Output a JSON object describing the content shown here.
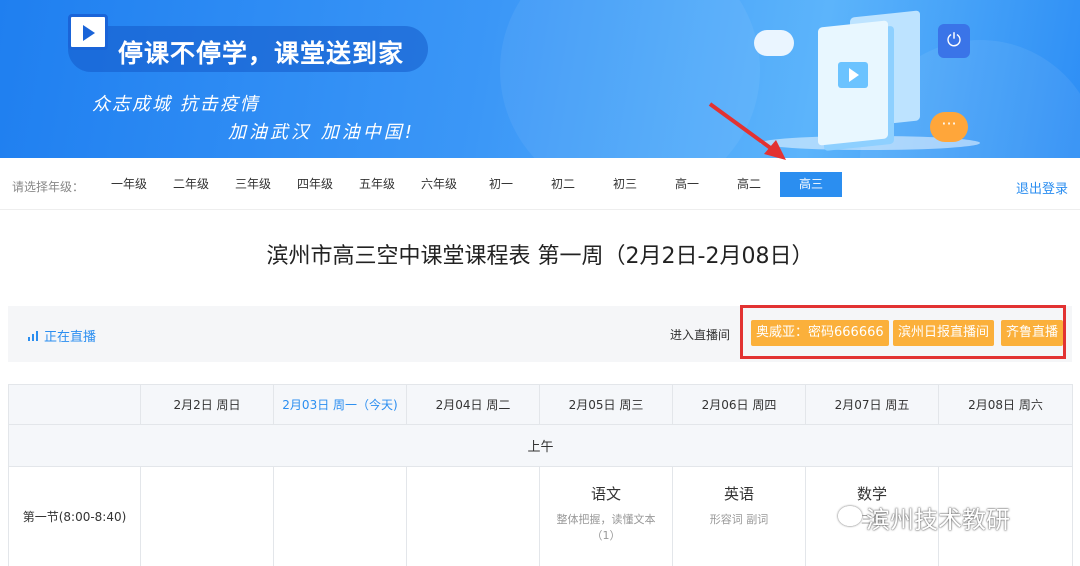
{
  "banner": {
    "title": "停课不停学，课堂送到家",
    "slogan_line1": "众志成城  抗击疫情",
    "slogan_line2": "加油武汉  加油中国!",
    "icon": "video-play-icon"
  },
  "grade_bar": {
    "label": "请选择年级：",
    "grades": [
      "一年级",
      "二年级",
      "三年级",
      "四年级",
      "五年级",
      "六年级",
      "初一",
      "初二",
      "初三",
      "高一",
      "高二",
      "高三"
    ],
    "selected": "高三",
    "logout": "退出登录"
  },
  "page_title": "滨州市高三空中课堂课程表 第一周（2月2日-2月08日）",
  "live_bar": {
    "status": "正在直播",
    "enter_label": "进入直播间",
    "buttons": [
      "奥威亚：密码666666",
      "滨州日报直播间",
      "齐鲁直播"
    ]
  },
  "schedule": {
    "headers": [
      "",
      "2月2日 周日",
      "2月03日 周一（今天)",
      "2月04日 周二",
      "2月05日 周三",
      "2月06日 周四",
      "2月07日 周五",
      "2月08日 周六"
    ],
    "section": "上午",
    "periods": [
      {
        "label": "第一节(8:00-8:40)",
        "cells": [
          {
            "subject": "",
            "topic": ""
          },
          {
            "subject": "",
            "topic": ""
          },
          {
            "subject": "",
            "topic": ""
          },
          {
            "subject": "语文",
            "topic": "整体把握，读懂文本（1）"
          },
          {
            "subject": "英语",
            "topic": "形容词 副词"
          },
          {
            "subject": "数学",
            "topic": "三角"
          },
          {
            "subject": "",
            "topic": ""
          }
        ]
      }
    ]
  },
  "watermark": "滨州技术教研",
  "colors": {
    "accent": "#2b8ef0",
    "live_button": "#fbb03b",
    "highlight_box": "#e23232"
  }
}
